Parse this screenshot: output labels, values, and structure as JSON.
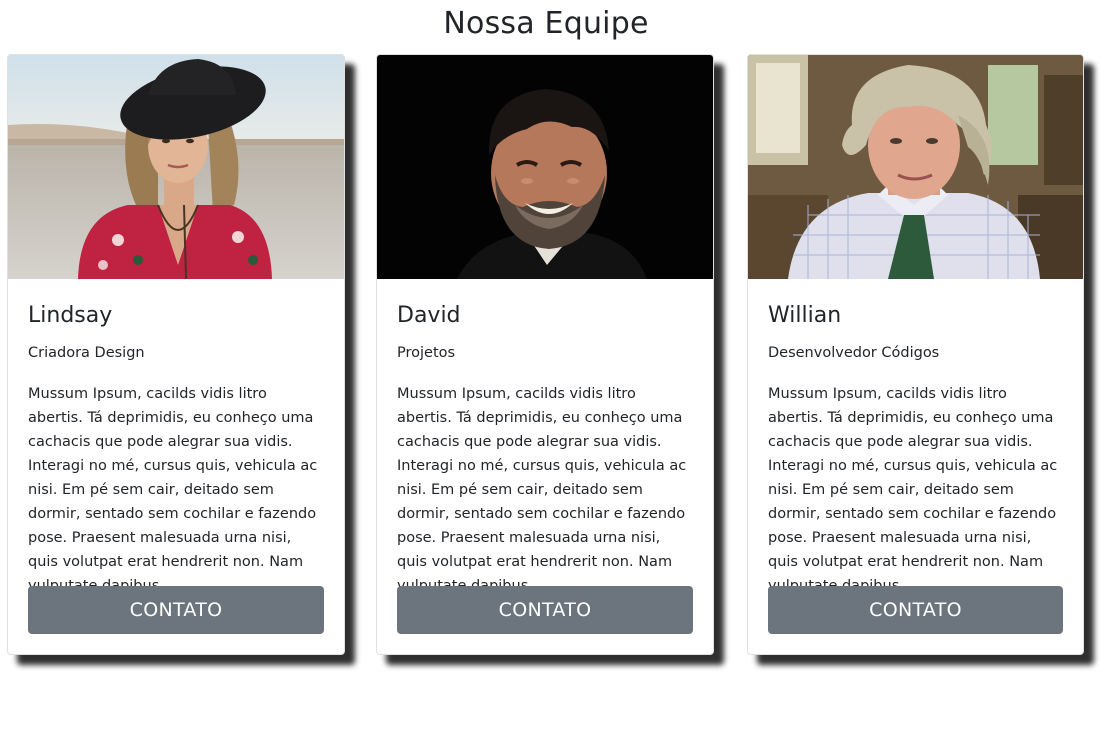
{
  "page": {
    "title": "Nossa Equipe"
  },
  "team": [
    {
      "name": "Lindsay",
      "role": "Criadora Design",
      "bio": "Mussum Ipsum, cacilds vidis litro abertis. Tá deprimidis, eu conheço uma cachacis que pode alegrar sua vidis. Interagi no mé, cursus quis, vehicula ac nisi. Em pé sem cair, deitado sem dormir, sentado sem cochilar e fazendo pose. Praesent malesuada urna nisi, quis volutpat erat hendrerit non. Nam vulputate dapibus.",
      "button_label": "CONTATO"
    },
    {
      "name": "David",
      "role": "Projetos",
      "bio": "Mussum Ipsum, cacilds vidis litro abertis. Tá deprimidis, eu conheço uma cachacis que pode alegrar sua vidis. Interagi no mé, cursus quis, vehicula ac nisi. Em pé sem cair, deitado sem dormir, sentado sem cochilar e fazendo pose. Praesent malesuada urna nisi, quis volutpat erat hendrerit non. Nam vulputate dapibus.",
      "button_label": "CONTATO"
    },
    {
      "name": "Willian",
      "role": "Desenvolvedor Códigos",
      "bio": "Mussum Ipsum, cacilds vidis litro abertis. Tá deprimidis, eu conheço uma cachacis que pode alegrar sua vidis. Interagi no mé, cursus quis, vehicula ac nisi. Em pé sem cair, deitado sem dormir, sentado sem cochilar e fazendo pose. Praesent malesuada urna nisi, quis volutpat erat hendrerit non. Nam vulputate dapibus.",
      "button_label": "CONTATO"
    }
  ],
  "colors": {
    "button_bg": "#6c757d",
    "button_text": "#ffffff",
    "text": "#212529"
  }
}
